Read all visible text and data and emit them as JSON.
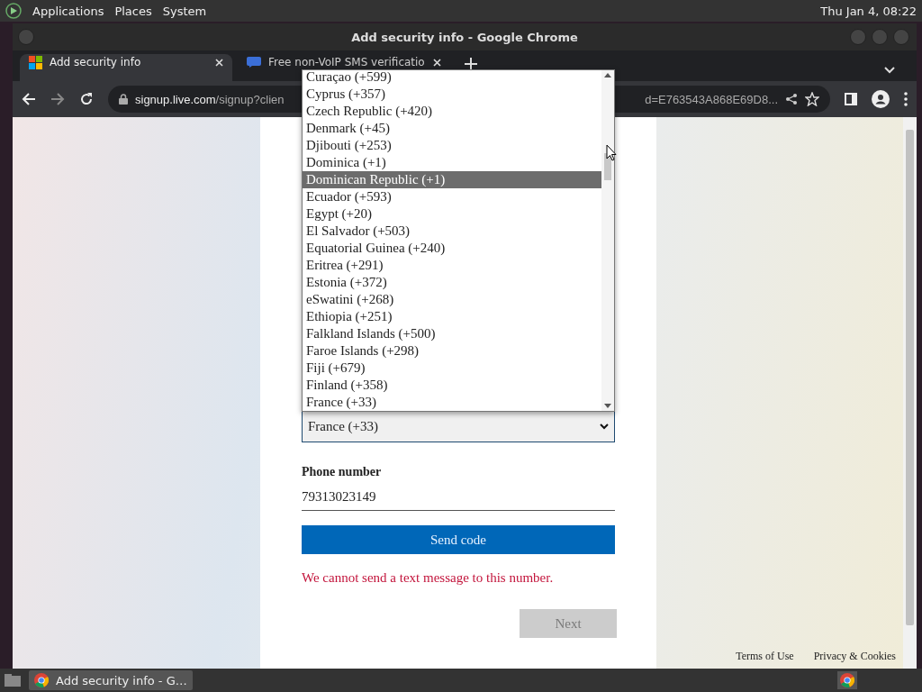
{
  "top_panel": {
    "menus": [
      "Applications",
      "Places",
      "System"
    ],
    "clock": "Thu Jan  4, 08:22"
  },
  "window": {
    "title": "Add security info - Google Chrome"
  },
  "tabs": [
    {
      "title": "Add security info",
      "selected": true,
      "kind": "windows"
    },
    {
      "title": "Free non-VoIP SMS verificatio",
      "selected": false,
      "kind": "sms"
    }
  ],
  "address_bar": {
    "host": "signup.live.com",
    "path": "/signup?clien",
    "tail": "d=E763543A868E69D8..."
  },
  "dropdown": {
    "options": [
      {
        "label": "Curaçao (+599)",
        "selected": false
      },
      {
        "label": "Cyprus (+357)",
        "selected": false
      },
      {
        "label": "Czech Republic (+420)",
        "selected": false
      },
      {
        "label": "Denmark (+45)",
        "selected": false
      },
      {
        "label": "Djibouti (+253)",
        "selected": false
      },
      {
        "label": "Dominica (+1)",
        "selected": false
      },
      {
        "label": "Dominican Republic (+1)",
        "selected": true
      },
      {
        "label": "Ecuador (+593)",
        "selected": false
      },
      {
        "label": "Egypt (+20)",
        "selected": false
      },
      {
        "label": "El Salvador (+503)",
        "selected": false
      },
      {
        "label": "Equatorial Guinea (+240)",
        "selected": false
      },
      {
        "label": "Eritrea (+291)",
        "selected": false
      },
      {
        "label": "Estonia (+372)",
        "selected": false
      },
      {
        "label": "eSwatini (+268)",
        "selected": false
      },
      {
        "label": "Ethiopia (+251)",
        "selected": false
      },
      {
        "label": "Falkland Islands (+500)",
        "selected": false
      },
      {
        "label": "Faroe Islands (+298)",
        "selected": false
      },
      {
        "label": "Fiji (+679)",
        "selected": false
      },
      {
        "label": "Finland (+358)",
        "selected": false
      },
      {
        "label": "France (+33)",
        "selected": false
      }
    ]
  },
  "form": {
    "country_value": "France (+33)",
    "phone_label": "Phone number",
    "phone_value": "79313023149",
    "send_button": "Send code",
    "error": "We cannot send a text message to this number.",
    "next_button": {
      "label": "Next",
      "disabled": true
    }
  },
  "footer": {
    "links": [
      "Terms of Use",
      "Privacy & Cookies"
    ]
  },
  "taskbar": {
    "task": "Add security info - G…"
  }
}
